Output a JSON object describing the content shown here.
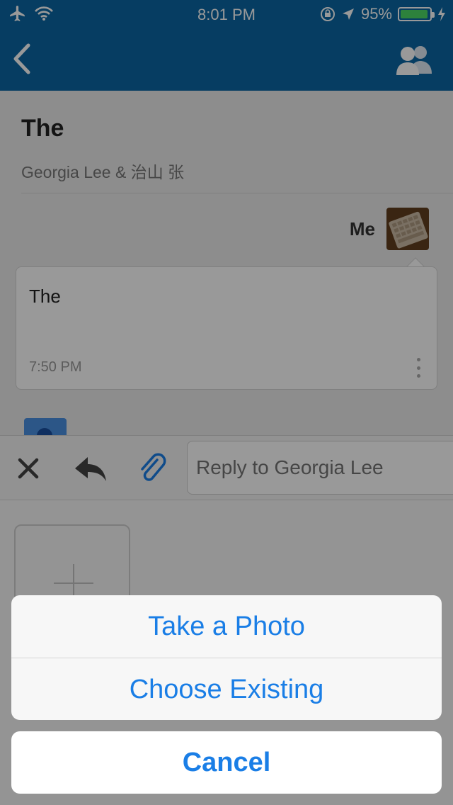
{
  "status_bar": {
    "time": "8:01 PM",
    "battery_percent": "95%",
    "battery_level": 0.95,
    "icons": [
      "airplane-icon",
      "wifi-icon",
      "rotation-lock-icon",
      "location-icon",
      "charging-icon"
    ]
  },
  "nav": {
    "back_icon": "chevron-left-icon",
    "right_icon": "people-icon"
  },
  "thread": {
    "subject": "The",
    "participants": "Georgia Lee & 治山 张",
    "message": {
      "sender": "Me",
      "body": "The",
      "time": "7:50 PM"
    }
  },
  "reply_bar": {
    "placeholder": "Reply to Georgia Lee",
    "icons": [
      "close-icon",
      "reply-icon",
      "paperclip-icon"
    ]
  },
  "action_sheet": {
    "take_photo": "Take a Photo",
    "choose_existing": "Choose Existing",
    "cancel": "Cancel"
  },
  "colors": {
    "nav_blue": "#0b67a3",
    "action_blue": "#1a7ee6",
    "battery_green": "#4cd964"
  }
}
